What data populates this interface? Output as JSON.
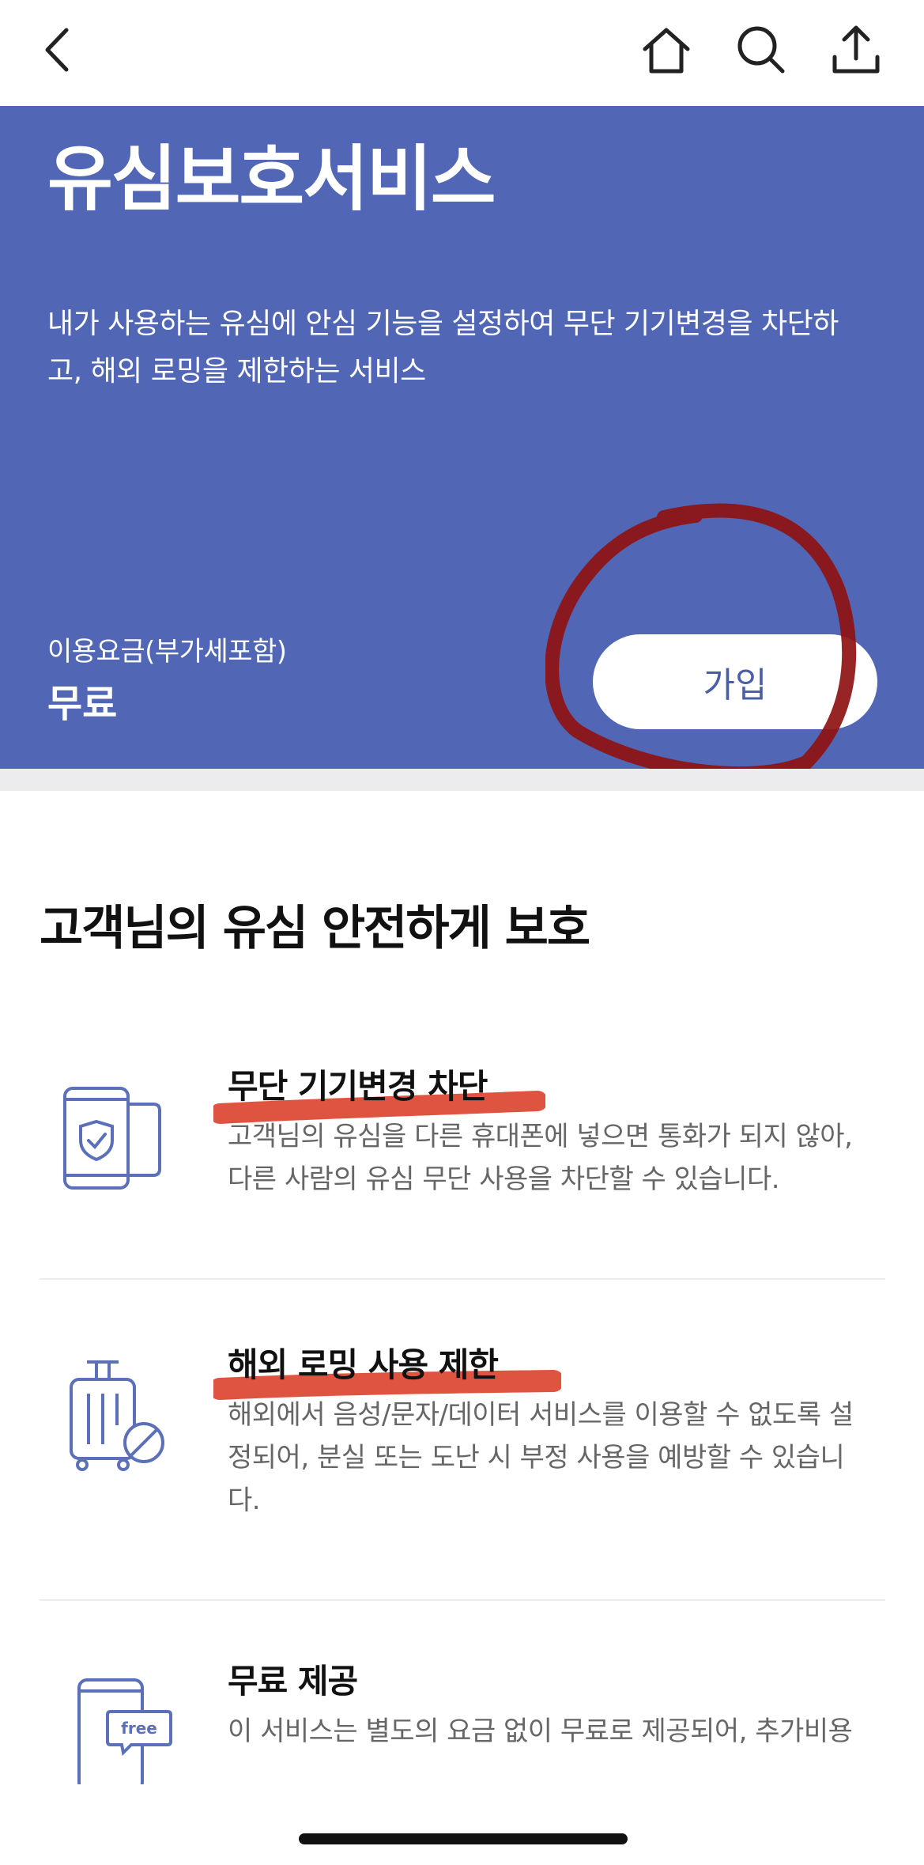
{
  "topbar": {
    "back_icon": "chevron-left-icon",
    "home_icon": "home-icon",
    "search_icon": "search-icon",
    "share_icon": "share-icon"
  },
  "hero": {
    "title": "유심보호서비스",
    "description": "내가 사용하는 유심에 안심 기능을 설정하여 무단 기기변경을 차단하고, 해외 로밍을 제한하는 서비스",
    "fee_label": "이용요금(부가세포함)",
    "fee_value": "무료",
    "join_button": "가입",
    "background_color": "#5167b5",
    "annotation_color": "#8e1212"
  },
  "section": {
    "title": "고객님의 유심 안전하게 보호"
  },
  "features": [
    {
      "icon": "phone-shield-icon",
      "title": "무단 기기변경 차단",
      "description": "고객님의 유심을 다른 휴대폰에 넣으면 통화가 되지 않아, 다른 사람의 유심 무단 사용을 차단할 수 있습니다."
    },
    {
      "icon": "luggage-blocked-icon",
      "title": "해외 로밍 사용 제한",
      "description": "해외에서 음성/문자/데이터 서비스를 이용할 수 없도록 설정되어, 분실 또는 도난 시 부정 사용을 예방할 수 있습니다."
    },
    {
      "icon": "phone-free-icon",
      "title": "무료 제공",
      "description": "이 서비스는 별도의 요금 없이 무료로 제공되어, 추가비용"
    }
  ],
  "colors": {
    "icon_stroke": "#5b70b8",
    "highlight_marker": "#d9361e"
  }
}
